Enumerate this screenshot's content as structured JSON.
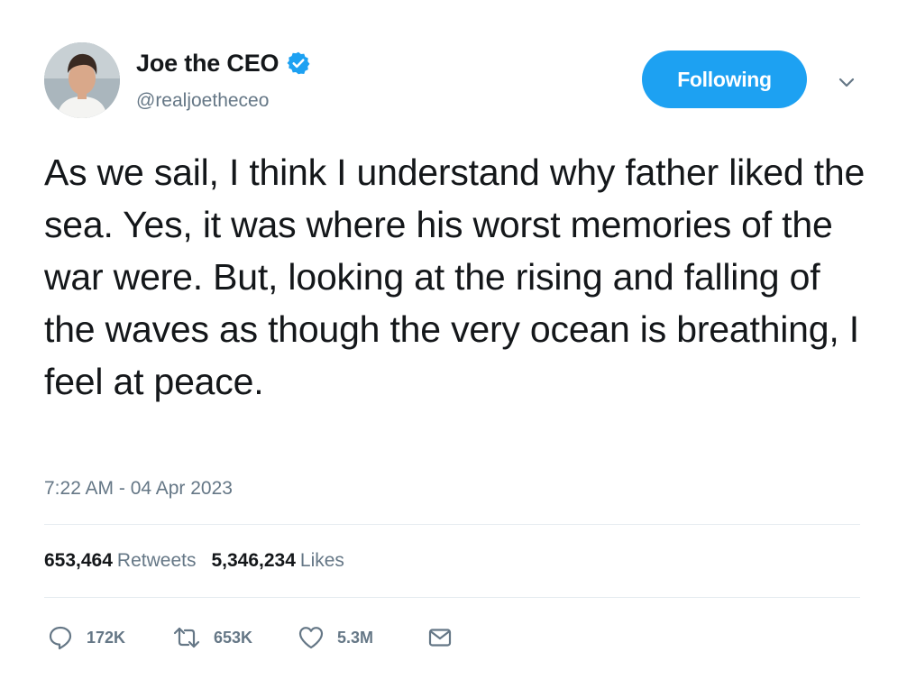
{
  "user": {
    "display_name": "Joe the CEO",
    "handle": "@realjoetheceo",
    "verified": true,
    "avatar_icon": "profile-photo"
  },
  "follow_button": {
    "label": "Following"
  },
  "menu": {
    "icon": "chevron-down-icon"
  },
  "tweet": {
    "text": "As we sail, I think I understand why father liked the sea. Yes, it was where his worst memories of the war were. But, looking at the rising and falling of the waves as though the very ocean is breathing, I feel at peace.",
    "timestamp": "7:22 AM - 04 Apr 2023"
  },
  "stats": {
    "retweets_count": "653,464",
    "retweets_label": "Retweets",
    "likes_count": "5,346,234",
    "likes_label": "Likes"
  },
  "actions": {
    "reply_count": "172K",
    "retweet_count": "653K",
    "like_count": "5.3M",
    "reply_icon": "reply-icon",
    "retweet_icon": "retweet-icon",
    "like_icon": "heart-icon",
    "message_icon": "direct-message-icon"
  },
  "colors": {
    "accent": "#1da1f2",
    "text": "#14171a",
    "secondary": "#657786",
    "divider": "#e6ecf0"
  }
}
